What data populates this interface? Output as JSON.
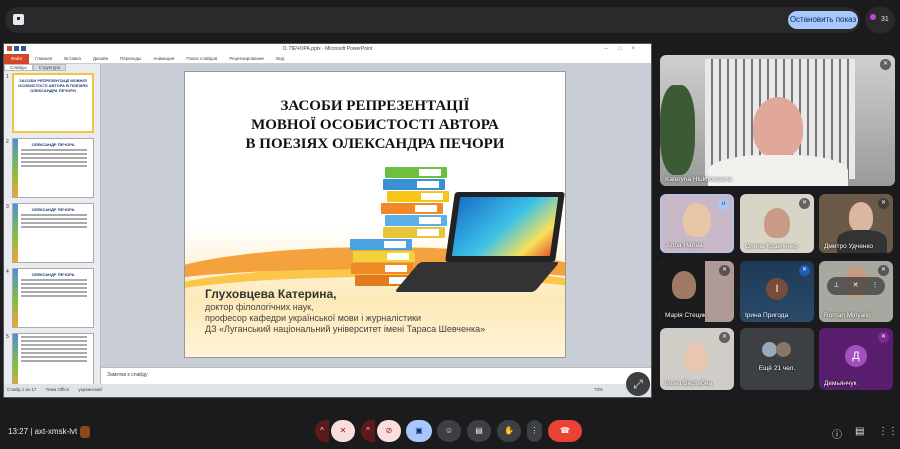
{
  "topbar": {
    "stop_label": "Остановить показ",
    "participant_count": "31"
  },
  "ppt": {
    "window_title": "О. ПЕЧОРА.pptx - Microsoft PowerPoint",
    "ribbon_tabs": [
      "Файл",
      "Главная",
      "Вставка",
      "Дизайн",
      "Переходы",
      "Анимация",
      "Показ слайдов",
      "Рецензирование",
      "Вид"
    ],
    "panel_tabs": [
      "Слайды",
      "Структура"
    ],
    "thumbnails": [
      {
        "num": "1",
        "title": "ЗАСОБИ РЕПРЕЗЕНТАЦІЇ МОВНОЇ ОСОБИСТОСТІ АВТОРА В ПОЕЗІЯХ ОЛЕКСАНДРА ПЕЧОРИ"
      },
      {
        "num": "2",
        "title": "ОЛЕКСАНДР ПЕЧОРА"
      },
      {
        "num": "3",
        "title": "ОЛЕКСАНДР ПЕЧОРА"
      },
      {
        "num": "4",
        "title": "ОЛЕКСАНДР ПЕЧОРА"
      },
      {
        "num": "5",
        "title": ""
      }
    ],
    "slide": {
      "title_lines": [
        "ЗАСОБИ РЕПРЕЗЕНТАЦІЇ",
        "МОВНОЇ ОСОБИСТОСТІ АВТОРА",
        "В ПОЕЗІЯХ ОЛЕКСАНДРА ПЕЧОРИ"
      ],
      "author": "Глуховцева Катерина,",
      "author_lines": [
        "доктор філологічних наук,",
        "професор кафедри української мови і журналістики",
        "ДЗ «Луганський національний університет імені Тараса Шевченка»"
      ]
    },
    "notes_placeholder": "Заметки к слайду",
    "status": {
      "slide": "Слайд 1 из 17",
      "theme": "Тема Office",
      "lang": "украинский",
      "zoom": "73%"
    }
  },
  "participants": {
    "main": "Kateryna Hlukhovtseva",
    "grid": [
      {
        "name": "Алла Нагіна",
        "speaking": true
      },
      {
        "name": "Олена Кравченко"
      },
      {
        "name": "Дмитро Удченко"
      },
      {
        "name": "Марія Стецик"
      },
      {
        "name": "Ірина Пригода",
        "initial": "І"
      },
      {
        "name": "Roman Minyailo"
      },
      {
        "name": "Ілона Вертебна"
      },
      {
        "name": "Ещё 21 чел."
      },
      {
        "name": "Демьянчук",
        "initial": "Д"
      }
    ]
  },
  "bottom": {
    "time": "13:27",
    "meeting_code": "axt-xmsk-lvt"
  },
  "colors": {
    "accent": "#a8c7fa",
    "end_call": "#ea4335",
    "mic_off": "#f9dedc"
  }
}
